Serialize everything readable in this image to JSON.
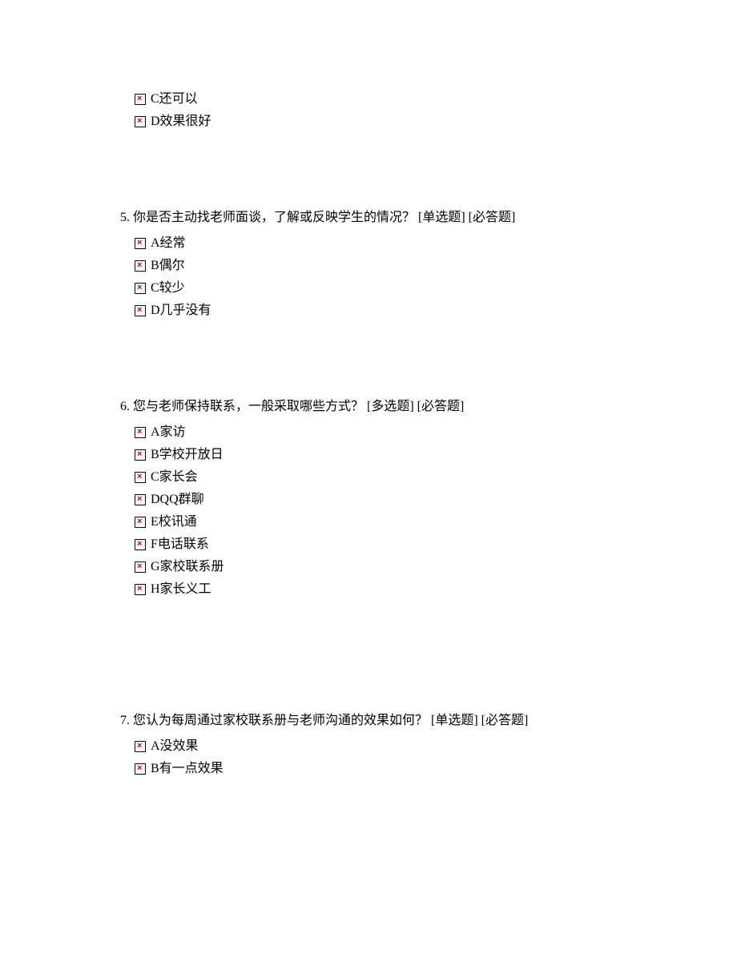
{
  "fragment_options": [
    {
      "label": "C还可以"
    },
    {
      "label": "D效果很好"
    }
  ],
  "questions": [
    {
      "number": "5.",
      "text": "你是否主动找老师面谈，了解或反映学生的情况？",
      "tags": " [单选题] [必答题]",
      "options": [
        {
          "label": "A经常"
        },
        {
          "label": "B偶尔"
        },
        {
          "label": "C较少"
        },
        {
          "label": "D几乎没有"
        }
      ]
    },
    {
      "number": "6.",
      "text": "您与老师保持联系，一般采取哪些方式？",
      "tags": " [多选题] [必答题]",
      "options": [
        {
          "label": "A家访"
        },
        {
          "label": "B学校开放日"
        },
        {
          "label": "C家长会"
        },
        {
          "label": "DQQ群聊"
        },
        {
          "label": "E校讯通"
        },
        {
          "label": "F电话联系"
        },
        {
          "label": "G家校联系册"
        },
        {
          "label": "H家长义工"
        }
      ]
    },
    {
      "number": "7.",
      "text": "您认为每周通过家校联系册与老师沟通的效果如何？",
      "tags": " [单选题] [必答题]",
      "options": [
        {
          "label": "A没效果"
        },
        {
          "label": "B有一点效果"
        }
      ]
    }
  ]
}
